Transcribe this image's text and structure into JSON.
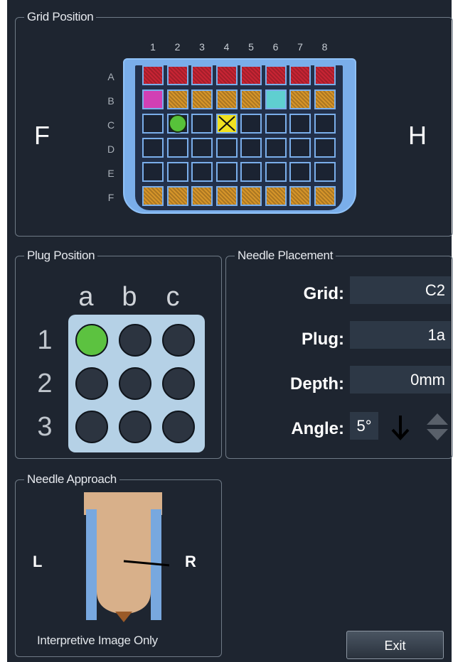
{
  "grid_position": {
    "title": "Grid Position",
    "left_side": "F",
    "right_side": "H",
    "columns": [
      "1",
      "2",
      "3",
      "4",
      "5",
      "6",
      "7",
      "8"
    ],
    "rows": [
      "A",
      "B",
      "C",
      "D",
      "E",
      "F"
    ],
    "cell_states": {
      "A": [
        "red",
        "red",
        "red",
        "red",
        "red",
        "red",
        "red",
        "red"
      ],
      "B": [
        "magenta",
        "orange",
        "orange",
        "orange",
        "orange",
        "cyan",
        "orange",
        "orange"
      ],
      "C": [
        "empty",
        "green-marker",
        "empty",
        "yellow-x",
        "empty",
        "empty",
        "empty",
        "empty"
      ],
      "D": [
        "empty",
        "empty",
        "empty",
        "empty",
        "empty",
        "empty",
        "empty",
        "empty"
      ],
      "E": [
        "empty",
        "empty",
        "empty",
        "empty",
        "empty",
        "empty",
        "empty",
        "empty"
      ],
      "F": [
        "orange",
        "orange",
        "orange",
        "orange",
        "orange",
        "orange",
        "orange",
        "orange"
      ]
    },
    "colors": {
      "red": "#c82434",
      "orange": "#d6952a",
      "magenta": "#d140b4",
      "cyan": "#5fcfd0",
      "green": "#57c23a",
      "yellow": "#f0e020",
      "plate": "#7aaeea"
    }
  },
  "plug_position": {
    "title": "Plug Position",
    "columns": [
      "a",
      "b",
      "c"
    ],
    "rows": [
      "1",
      "2",
      "3"
    ],
    "selected": "1a"
  },
  "needle_placement": {
    "title": "Needle Placement",
    "grid_label": "Grid:",
    "grid_value": "C2",
    "plug_label": "Plug:",
    "plug_value": "1a",
    "depth_label": "Depth:",
    "depth_value": "0mm",
    "angle_label": "Angle:",
    "angle_value": "5°",
    "direction_icon": "arrow-down-icon",
    "stepper_icon": "up-down-stepper-icon"
  },
  "needle_approach": {
    "title": "Needle Approach",
    "left_label": "L",
    "right_label": "R",
    "caption": "Interpretive Image Only"
  },
  "exit_label": "Exit"
}
